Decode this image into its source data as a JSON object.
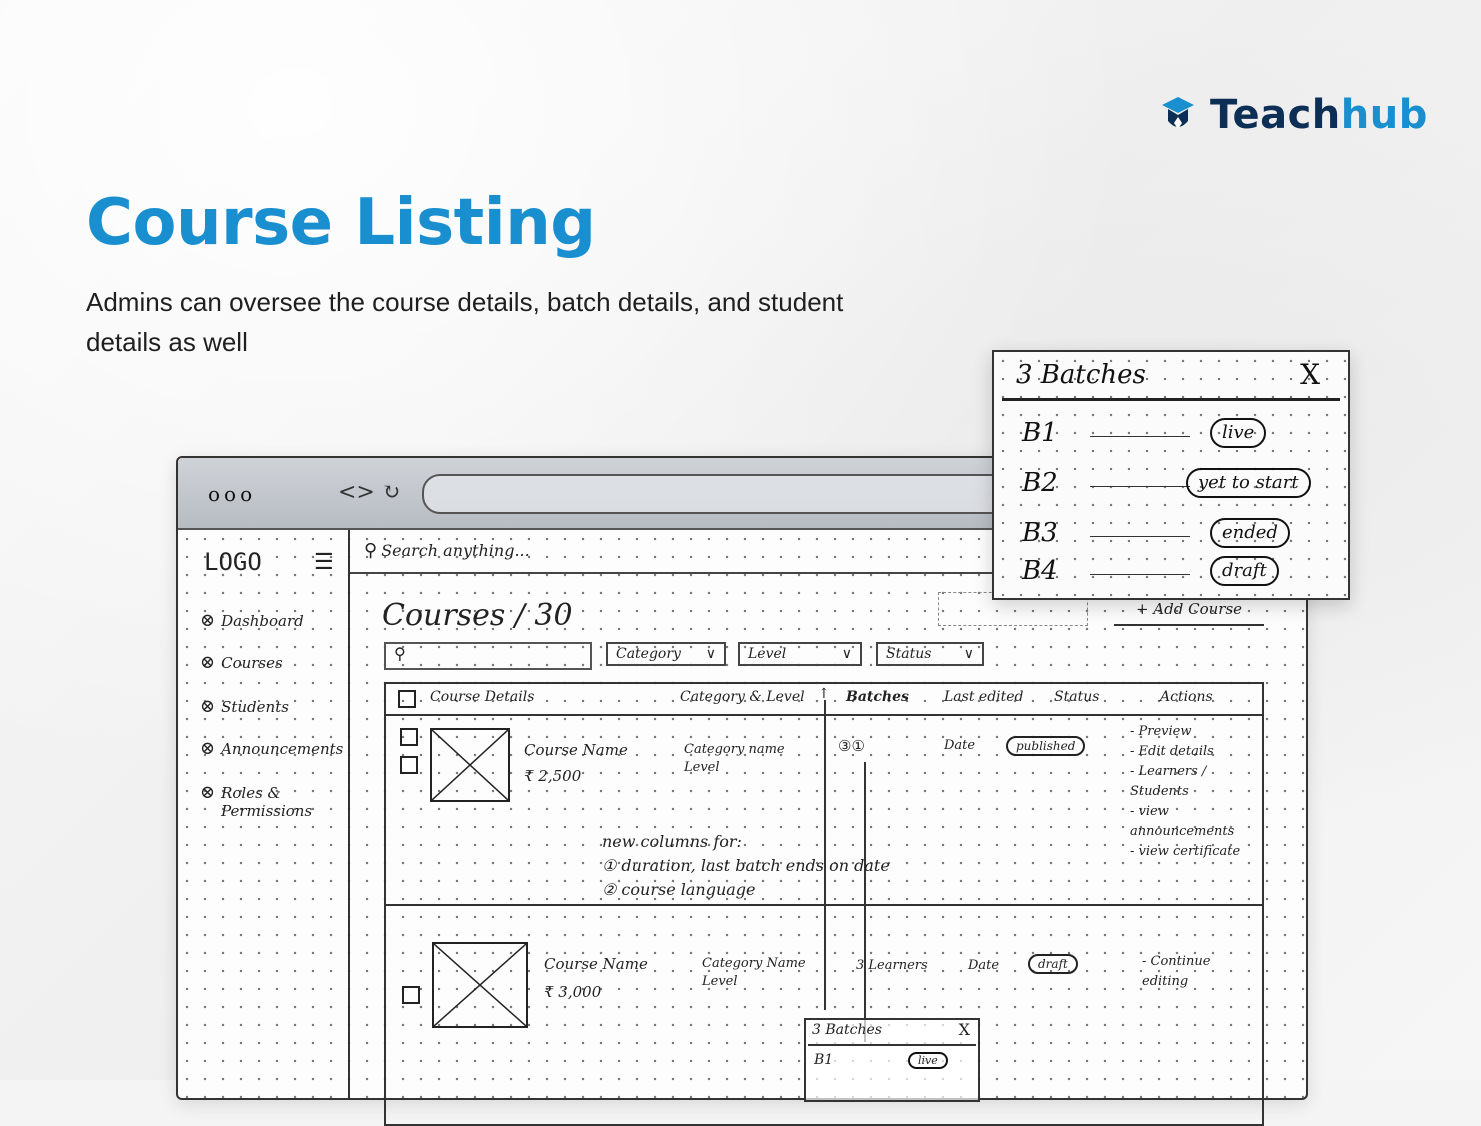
{
  "brand": {
    "name_part1": "Teach",
    "name_part2": "hub"
  },
  "page": {
    "title": "Course Listing",
    "subtitle": "Admins can oversee the course details, batch details, and student details as well"
  },
  "sketch": {
    "browser": {
      "dots": "ooo",
      "nav": "<> ↻"
    },
    "sidebar": {
      "logo": "LOGO",
      "items": [
        {
          "label": "Dashboard"
        },
        {
          "label": "Courses"
        },
        {
          "label": "Students"
        },
        {
          "label": "Announcements"
        },
        {
          "label": "Roles & Permissions"
        }
      ]
    },
    "search": {
      "label": "Search anything..."
    },
    "courses": {
      "title": "Courses / 30",
      "add_button": "+ Add Course"
    },
    "filters": {
      "category": "Category",
      "level": "Level",
      "status": "Status"
    },
    "table": {
      "headers": {
        "details": "Course Details",
        "category": "Category & Level",
        "batches": "Batches",
        "last_edited": "Last edited",
        "status": "Status",
        "actions": "Actions"
      },
      "rows": [
        {
          "name": "Course Name",
          "price": "₹ 2,500",
          "category": "Category name",
          "level": "Level",
          "batches": "③①",
          "date": "Date",
          "status": "published",
          "actions": [
            "- Preview",
            "- Edit details",
            "- Learners / Students",
            "- view announcements",
            "- view certificate"
          ]
        },
        {
          "name": "Course Name",
          "price": "₹ 3,000",
          "category": "Category Name",
          "level": "Level",
          "batches": "3 Learners",
          "date": "Date",
          "status": "draft",
          "actions": [
            "- Continue editing"
          ]
        }
      ]
    },
    "note": {
      "line1": "new columns for:",
      "line2": "① duration, last batch ends on date",
      "line3": "② course language"
    },
    "popover": {
      "title": "3 Batches",
      "close": "X",
      "batches": [
        {
          "label": "B1",
          "status": "live"
        },
        {
          "label": "B2",
          "status": "yet to start"
        },
        {
          "label": "B3",
          "status": "ended"
        },
        {
          "label": "B4",
          "status": "draft"
        }
      ]
    },
    "mini_popover": {
      "title": "3 Batches",
      "close": "X",
      "batch": "B1",
      "status": "live"
    }
  }
}
